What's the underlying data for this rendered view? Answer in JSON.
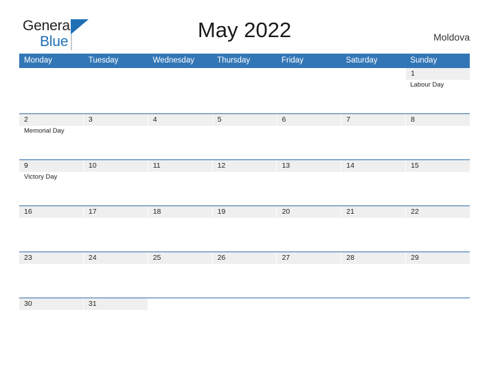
{
  "header": {
    "logo_line1": "General",
    "logo_line2": "Blue",
    "title": "May 2022",
    "country": "Moldova"
  },
  "colors": {
    "header_blue": "#3276b6",
    "row_divider_blue": "#2f6ea8",
    "date_band_gray": "#efefef",
    "logo_blue": "#1f6fb5",
    "text_dark": "#222222"
  },
  "calendar": {
    "weekdays": [
      "Monday",
      "Tuesday",
      "Wednesday",
      "Thursday",
      "Friday",
      "Saturday",
      "Sunday"
    ],
    "weeks": [
      {
        "days": [
          {
            "date": "",
            "event": ""
          },
          {
            "date": "",
            "event": ""
          },
          {
            "date": "",
            "event": ""
          },
          {
            "date": "",
            "event": ""
          },
          {
            "date": "",
            "event": ""
          },
          {
            "date": "",
            "event": ""
          },
          {
            "date": "1",
            "event": "Labour Day"
          }
        ]
      },
      {
        "days": [
          {
            "date": "2",
            "event": "Memorial Day"
          },
          {
            "date": "3",
            "event": ""
          },
          {
            "date": "4",
            "event": ""
          },
          {
            "date": "5",
            "event": ""
          },
          {
            "date": "6",
            "event": ""
          },
          {
            "date": "7",
            "event": ""
          },
          {
            "date": "8",
            "event": ""
          }
        ]
      },
      {
        "days": [
          {
            "date": "9",
            "event": "Victory Day"
          },
          {
            "date": "10",
            "event": ""
          },
          {
            "date": "11",
            "event": ""
          },
          {
            "date": "12",
            "event": ""
          },
          {
            "date": "13",
            "event": ""
          },
          {
            "date": "14",
            "event": ""
          },
          {
            "date": "15",
            "event": ""
          }
        ]
      },
      {
        "days": [
          {
            "date": "16",
            "event": ""
          },
          {
            "date": "17",
            "event": ""
          },
          {
            "date": "18",
            "event": ""
          },
          {
            "date": "19",
            "event": ""
          },
          {
            "date": "20",
            "event": ""
          },
          {
            "date": "21",
            "event": ""
          },
          {
            "date": "22",
            "event": ""
          }
        ]
      },
      {
        "days": [
          {
            "date": "23",
            "event": ""
          },
          {
            "date": "24",
            "event": ""
          },
          {
            "date": "25",
            "event": ""
          },
          {
            "date": "26",
            "event": ""
          },
          {
            "date": "27",
            "event": ""
          },
          {
            "date": "28",
            "event": ""
          },
          {
            "date": "29",
            "event": ""
          }
        ]
      },
      {
        "days": [
          {
            "date": "30",
            "event": ""
          },
          {
            "date": "31",
            "event": ""
          },
          {
            "date": "",
            "event": ""
          },
          {
            "date": "",
            "event": ""
          },
          {
            "date": "",
            "event": ""
          },
          {
            "date": "",
            "event": ""
          },
          {
            "date": "",
            "event": ""
          }
        ]
      }
    ]
  }
}
